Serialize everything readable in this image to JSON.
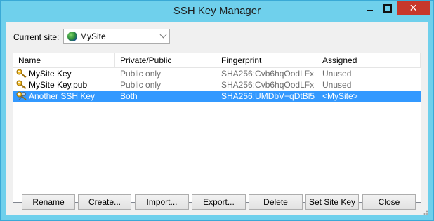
{
  "window": {
    "title": "SSH Key Manager"
  },
  "site": {
    "label": "Current site:",
    "value": "MySite"
  },
  "table": {
    "columns": [
      "Name",
      "Private/Public",
      "Fingerprint",
      "Assigned"
    ],
    "rows": [
      {
        "name": "MySite Key",
        "type": "Public only",
        "fingerprint": "SHA256:Cvb6hqOodLFx...",
        "assigned": "Unused",
        "icon": "key-icon",
        "selected": false
      },
      {
        "name": "MySite Key.pub",
        "type": "Public only",
        "fingerprint": "SHA256:Cvb6hqOodLFx...",
        "assigned": "Unused",
        "icon": "key-icon",
        "selected": false
      },
      {
        "name": "Another SSH Key",
        "type": "Both",
        "fingerprint": "SHA256:UMDbV+qDtBl5...",
        "assigned": "<MySite>",
        "icon": "keypair-icon",
        "selected": true
      }
    ]
  },
  "buttons": {
    "rename": "Rename",
    "create": "Create...",
    "import": "Import...",
    "export": "Export...",
    "delete": "Delete",
    "set_site_key": "Set Site Key",
    "close": "Close"
  },
  "colors": {
    "titlebar": "#6fd0ec",
    "selection": "#3399ff",
    "close_button": "#c7382b"
  }
}
